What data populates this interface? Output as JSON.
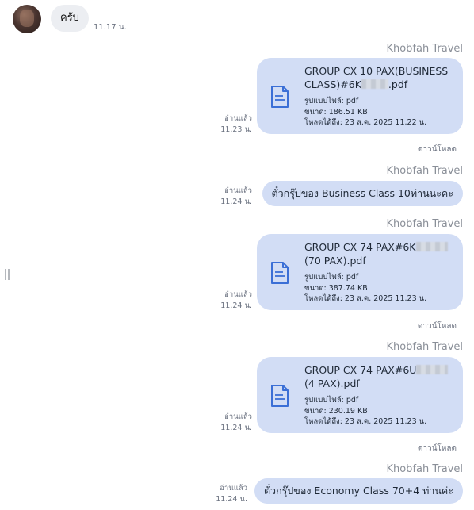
{
  "incoming": {
    "text": "ครับ",
    "time": "11.17 น."
  },
  "messages": [
    {
      "sender": "Khobfah Travel",
      "kind": "file",
      "filename_a": "GROUP CX 10 PAX(BUSINES",
      "filename_b": "S CLASS)#6K",
      "filename_c": ".pdf",
      "format": "รูปแบบไฟล์: pdf",
      "size": "ขนาด: 186.51 KB",
      "expiry": "โหลดได้ถึง: 23 ส.ค. 2025 11.22 น.",
      "read": "อ่านแล้ว",
      "time": "11.23 น.",
      "download": "ดาวน์โหลด"
    },
    {
      "sender": "Khobfah Travel",
      "kind": "text",
      "text": "ตั๋วกรุ๊ปของ Business Class 10ท่านนะคะ",
      "read": "อ่านแล้ว",
      "time": "11.24 น."
    },
    {
      "sender": "Khobfah Travel",
      "kind": "file",
      "filename_a": "GROUP CX 74 PAX#6K",
      "filename_b": "(70 PAX).pdf",
      "filename_c": "",
      "format": "รูปแบบไฟล์: pdf",
      "size": "ขนาด: 387.74 KB",
      "expiry": "โหลดได้ถึง: 23 ส.ค. 2025 11.23 น.",
      "read": "อ่านแล้ว",
      "time": "11.24 น.",
      "download": "ดาวน์โหลด"
    },
    {
      "sender": "Khobfah Travel",
      "kind": "file",
      "filename_a": "GROUP CX 74 PAX#6U",
      "filename_b": "(4 PAX).pdf",
      "filename_c": "",
      "format": "รูปแบบไฟล์: pdf",
      "size": "ขนาด: 230.19 KB",
      "expiry": "โหลดได้ถึง: 23 ส.ค. 2025 11.23 น.",
      "read": "อ่านแล้ว",
      "time": "11.24 น.",
      "download": "ดาวน์โหลด"
    },
    {
      "sender": "Khobfah Travel",
      "kind": "text",
      "text": "ตั๋วกรุ๊ปของ Economy Class 70+4 ท่านค่ะ",
      "read": "อ่านแล้ว",
      "time": "11.24 น."
    }
  ],
  "icons": {
    "file": "document-icon",
    "avatar": "avatar",
    "handle": "resize-handle-icon"
  },
  "colors": {
    "outgoing_bubble": "#d2ddf5",
    "incoming_bubble": "#eceef2",
    "file_icon": "#3b6fd6"
  }
}
